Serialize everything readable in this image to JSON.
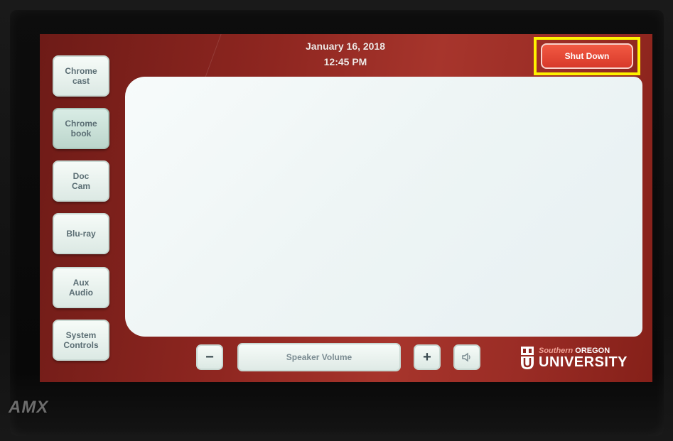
{
  "header": {
    "date": "January 16, 2018",
    "time": "12:45 PM",
    "shutdown_label": "Shut Down"
  },
  "sources": [
    {
      "label": "Chrome\ncast",
      "key": "chromecast"
    },
    {
      "label": "Chrome\nbook",
      "key": "chromebook"
    },
    {
      "label": "Doc\nCam",
      "key": "doc-cam"
    },
    {
      "label": "Blu-ray",
      "key": "blu-ray"
    },
    {
      "label": "Aux\nAudio",
      "key": "aux-audio"
    },
    {
      "label": "System\nControls",
      "key": "system-controls"
    }
  ],
  "volume": {
    "minus_label": "−",
    "label": "Speaker Volume",
    "plus_label": "+"
  },
  "logo": {
    "top_left": "Southern",
    "top_right": "OREGON",
    "bottom": "UNIVERSITY"
  },
  "device_brand": "AMX",
  "colors": {
    "highlight": "#fff200",
    "shutdown": "#d8392a",
    "frame": "#8e2620"
  }
}
